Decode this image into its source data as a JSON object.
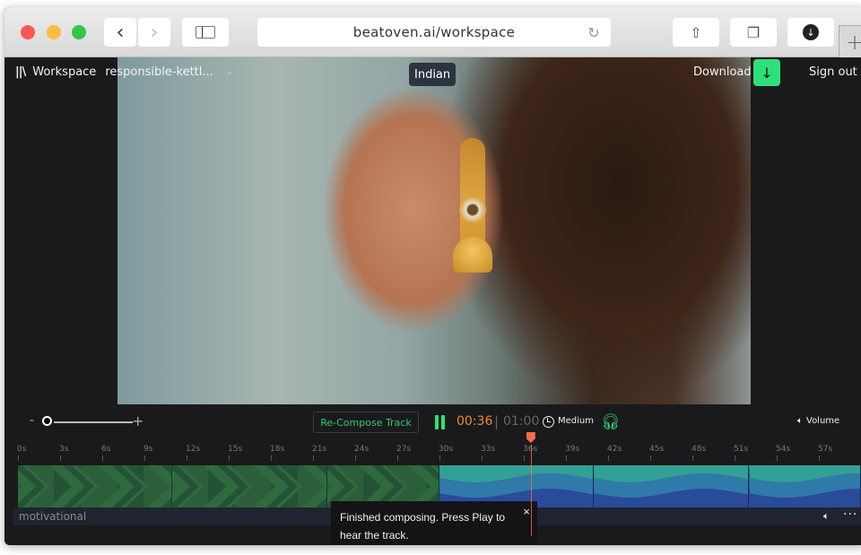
{
  "browser": {
    "url": "beatoven.ai/workspace",
    "icons": [
      "back-icon",
      "forward-icon",
      "sidebar-icon",
      "reload-icon",
      "share-icon",
      "tabs-icon",
      "downloads-icon",
      "new-tab-icon"
    ]
  },
  "header": {
    "workspace_label": "Workspace",
    "project_name": "responsible-kettl...",
    "genre_tag": "Indian",
    "download_label": "Download",
    "signout_label": "Sign out"
  },
  "controls": {
    "zoom_minus": "-",
    "zoom_plus": "+",
    "recompose_label": "Re-Compose Track",
    "current_time": "00:36",
    "separator": "|",
    "total_time": "01:00",
    "tempo": "Medium",
    "volume_label": "Volume"
  },
  "timeline": {
    "ticks": [
      "0s",
      "3s",
      "6s",
      "9s",
      "12s",
      "15s",
      "18s",
      "21s",
      "24s",
      "27s",
      "30s",
      "33s",
      "36s",
      "39s",
      "42s",
      "45s",
      "48s",
      "51s",
      "54s",
      "57s"
    ],
    "playhead_seconds": 36.5,
    "duration_seconds": 60,
    "segments": [
      {
        "style": "green",
        "start": 0,
        "end": 11
      },
      {
        "style": "green",
        "start": 11,
        "end": 22
      },
      {
        "style": "green",
        "start": 22,
        "end": 30
      },
      {
        "style": "blue",
        "start": 30,
        "end": 41
      },
      {
        "style": "blue",
        "start": 41,
        "end": 52
      },
      {
        "style": "blue",
        "start": 52,
        "end": 60
      }
    ],
    "track_label": "motivational"
  },
  "toast": {
    "message": "Finished composing. Press Play to hear the track.",
    "close": "×"
  },
  "colors": {
    "accent_green": "#2ee07a",
    "time_orange": "#f08a2a",
    "playhead": "#f26c4f"
  }
}
